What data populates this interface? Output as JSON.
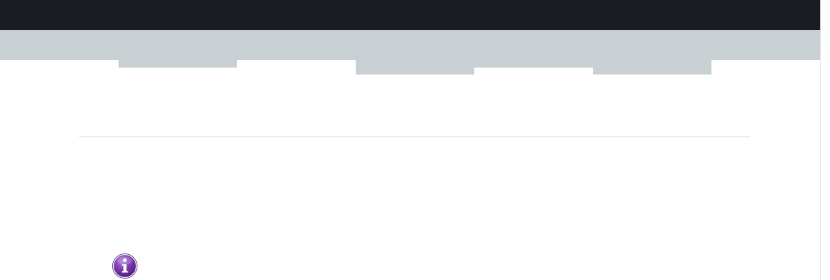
{
  "header": {
    "background": "#1b1c22"
  },
  "nav": {
    "background": "#c9d0d3",
    "tabs": [
      {
        "label": ""
      },
      {
        "label": ""
      },
      {
        "label": ""
      },
      {
        "label": ""
      }
    ]
  },
  "divider": {
    "color": "#d7d7d7"
  },
  "notice": {
    "icon": "info-icon",
    "icon_color": "#6a2d9b"
  }
}
